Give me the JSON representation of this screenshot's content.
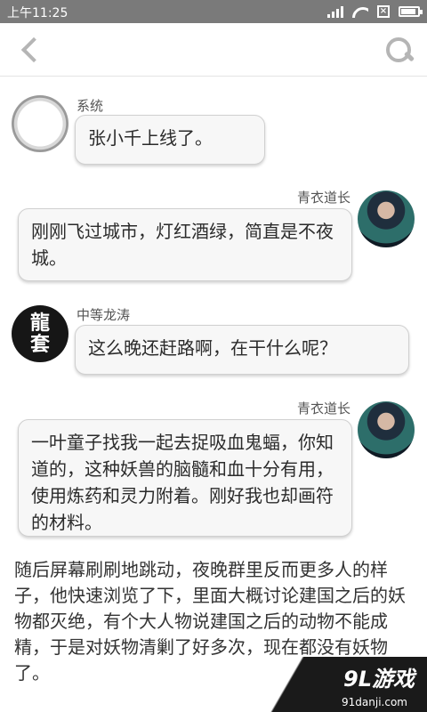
{
  "status_bar": {
    "time": "上午11:25"
  },
  "messages": [
    {
      "sender": "系统",
      "text": "张小千上线了。"
    },
    {
      "sender": "青衣道长",
      "text": "刚刚飞过城市，灯红酒绿，简直是不夜城。"
    },
    {
      "sender": "中等龙涛",
      "text": "这么晚还赶路啊，在干什么呢？"
    },
    {
      "sender": "青衣道长",
      "text": "一叶童子找我一起去捉吸血鬼蝠，你知道的，这种妖兽的脑髓和血十分有用，使用炼药和灵力附着。刚好我也却画符的材料。"
    }
  ],
  "avatars": {
    "dragon_text_top": "龍",
    "dragon_text_bottom": "套"
  },
  "narrative": "随后屏幕刷刷地跳动，夜晚群里反而更多人的样子，他快速浏览了下，里面大概讨论建国之后的妖物都灭绝，有个大人物说建国之后的动物不能成精，于是对妖物清剿了好多次，现在都没有妖物了。",
  "watermark": {
    "logo": "9L游戏",
    "url": "91danji.com"
  }
}
